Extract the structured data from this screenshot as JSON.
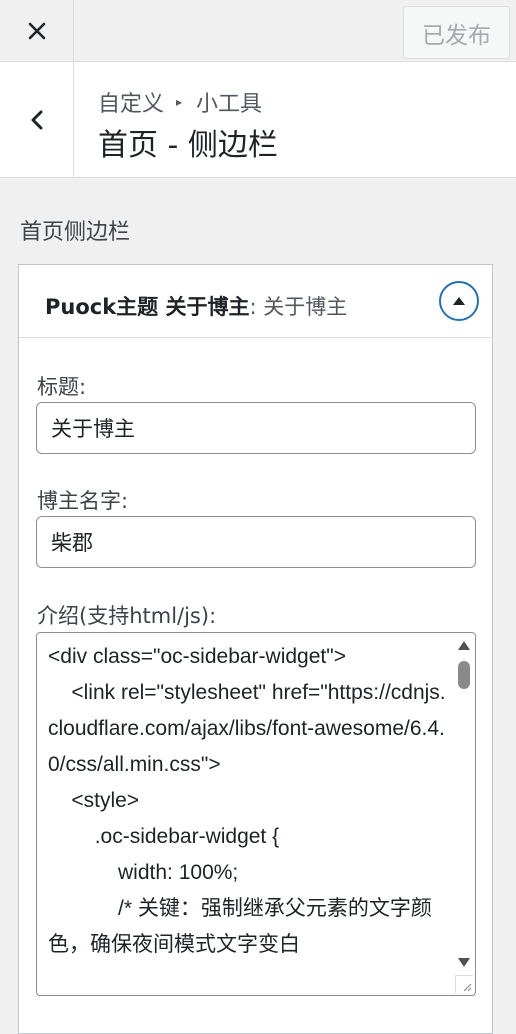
{
  "header": {
    "close_icon": "close-icon",
    "publish_label": "已发布"
  },
  "section": {
    "back_icon": "chevron-left-icon",
    "breadcrumb_parent": "自定义",
    "breadcrumb_sep": "▸",
    "breadcrumb_child": "小工具",
    "title": "首页 - 侧边栏"
  },
  "area": {
    "label": "首页侧边栏"
  },
  "widget": {
    "name": "Puock主题 关于博主",
    "subtitle": ": 关于博主",
    "toggle_icon": "chevron-up-icon",
    "fields": {
      "title_label": "标题:",
      "title_value": "关于博主",
      "name_label": "博主名字:",
      "name_value": "柴郡",
      "intro_label": "介绍(支持html/js):",
      "intro_value": "<div class=\"oc-sidebar-widget\">\n    <link rel=\"stylesheet\" href=\"https://cdnjs.cloudflare.com/ajax/libs/font-awesome/6.4.0/css/all.min.css\">\n    <style>\n        .oc-sidebar-widget {\n            width: 100%;\n            /* 关键：强制继承父元素的文字颜色，确保夜间模式文字变白"
    }
  },
  "colors": {
    "accent": "#2271b1",
    "background": "#f0f0f1"
  }
}
